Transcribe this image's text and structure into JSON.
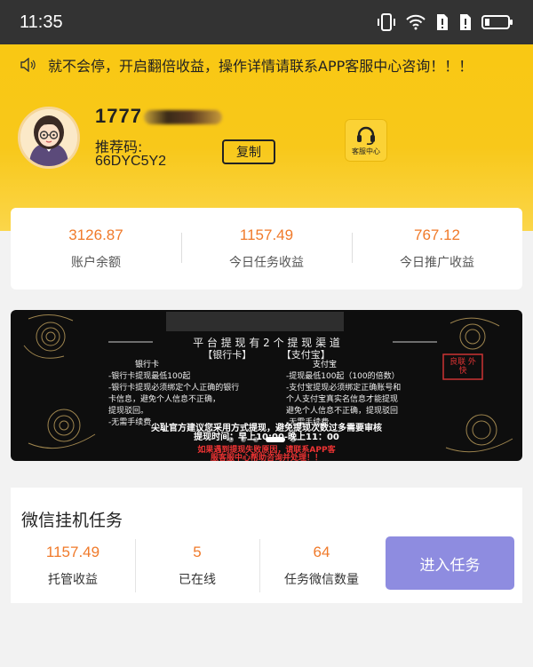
{
  "status_bar": {
    "time": "11:35"
  },
  "notice": {
    "text": "就不会停，开启翻倍收益，操作详情请联系APP客服中心咨询！！！"
  },
  "profile": {
    "phone_visible": "1777",
    "referral_label": "推荐码:",
    "referral_code": "66DYC5Y2",
    "copy_label": "复制",
    "service_label": "客服中心"
  },
  "stats": [
    {
      "value": "3126.87",
      "label": "账户余额"
    },
    {
      "value": "1157.49",
      "label": "今日任务收益"
    },
    {
      "value": "767.12",
      "label": "今日推广收益"
    }
  ],
  "banner": {
    "headline": "平 台 提 现 有 2 个 提 现 渠 道",
    "bank_card": "【银行卡】",
    "alipay": "【支付宝】",
    "col_left_title": "银行卡",
    "col_right_title": "支付宝",
    "left_lines": [
      "-银行卡提现最低100起",
      "-银行卡提现必须绑定个人正确的银行",
      "卡信息，避免个人信息不正确，",
      "提现驳回。",
      "-无需手续费"
    ],
    "right_lines": [
      "-提现最低100起（100的倍数）",
      "-支付宝提现必须绑定正确账号和",
      "个人支付宝真实名信息才能提现",
      "避免个人信息不正确，提现驳回",
      "-无需手续费"
    ],
    "stamp": "良联 外快",
    "tip": "尖耻官方建议您采用方式提现，避免提现次数过多需要审核",
    "time_line": "提现时间：早上10:00-晚上11：00",
    "red_line1": "如果遇到提现失败原因，请联系APP客",
    "red_line2": "服客服中心帮助咨询并处理！！"
  },
  "task": {
    "title": "微信挂机任务",
    "stats": [
      {
        "value": "1157.49",
        "label": "托管收益"
      },
      {
        "value": "5",
        "label": "已在线"
      },
      {
        "value": "64",
        "label": "任务微信数量"
      }
    ],
    "enter_label": "进入任务"
  }
}
